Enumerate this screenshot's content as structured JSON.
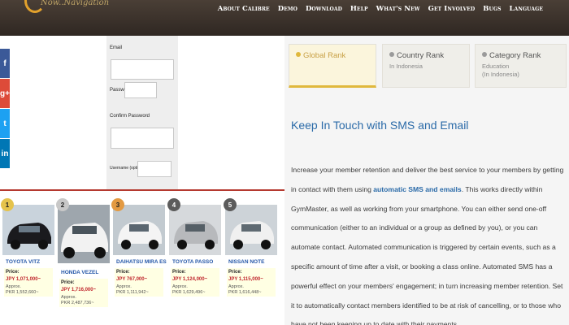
{
  "header": {
    "logo_text": "Now..Navigation",
    "nav": [
      "About Calibre",
      "Demo",
      "Download",
      "Help",
      "What's New",
      "Get Involved",
      "Bugs",
      "Language"
    ]
  },
  "social": [
    "f",
    "g+",
    "t",
    "in"
  ],
  "form": {
    "email_label": "Email",
    "password_label": "Password",
    "confirm_label": "Confirm Password",
    "username_label": "Username (optional)"
  },
  "cars": [
    {
      "rank": "1",
      "name": "TOYOTA VITZ",
      "price_label": "Price:",
      "jpy": "JPY 1,071,000~",
      "approx": "Approx.",
      "pkr": "PKR 1,552,660~",
      "color": "#1a1a1e"
    },
    {
      "rank": "2",
      "name": "HONDA VEZEL",
      "price_label": "Price:",
      "jpy": "JPY 1,716,000~",
      "approx": "Approx.",
      "pkr": "PKR 2,487,736~",
      "color": "#f2f2f2"
    },
    {
      "rank": "3",
      "name": "DAIHATSU MIRA ES",
      "price_label": "Price:",
      "jpy": "JPY 767,000~",
      "approx": "Approx.",
      "pkr": "PKR 1,111,942~",
      "color": "#f4f4f4"
    },
    {
      "rank": "4",
      "name": "TOYOTA PASSO",
      "price_label": "Price:",
      "jpy": "JPY 1,124,000~",
      "approx": "Approx.",
      "pkr": "PKR 1,629,496~",
      "color": "#b7b9bc"
    },
    {
      "rank": "5",
      "name": "NISSAN NOTE",
      "price_label": "Price:",
      "jpy": "JPY 1,115,000~",
      "approx": "Approx.",
      "pkr": "PKR 1,616,448~",
      "color": "#f0f0f0"
    }
  ],
  "tabs": [
    {
      "title": "Global Rank",
      "sub1": "",
      "sub2": ""
    },
    {
      "title": "Country Rank",
      "sub1": "In Indonesia",
      "sub2": ""
    },
    {
      "title": "Category Rank",
      "sub1": "Education",
      "sub2": "(In Indonesia)"
    }
  ],
  "article": {
    "heading": "Keep In Touch with SMS and Email",
    "p1": "Increase your member retention and deliver the best service to your members by getting in contact with them using ",
    "link": "automatic SMS and emails",
    "p2": ". This works directly within GymMaster, as well as working from your smartphone. You can either send one-off communication (either to an individual or a group as defined by you), or you can automate contact. Automated communication is triggered by certain events, such as a specific amount of time after a visit, or booking a class online. Automated SMS has a powerful effect on your members' engagement; in turn increasing member retention. Set it to automatically contact members identified to be at risk of cancelling, or to those who have not been keeping up to date with their payments."
  },
  "colors": {
    "header_bg": "#3a302a",
    "accent_gold": "#e0b83c",
    "link_blue": "#2a6aa8",
    "price_red": "#c0262d",
    "rule_red": "#b5392f"
  }
}
